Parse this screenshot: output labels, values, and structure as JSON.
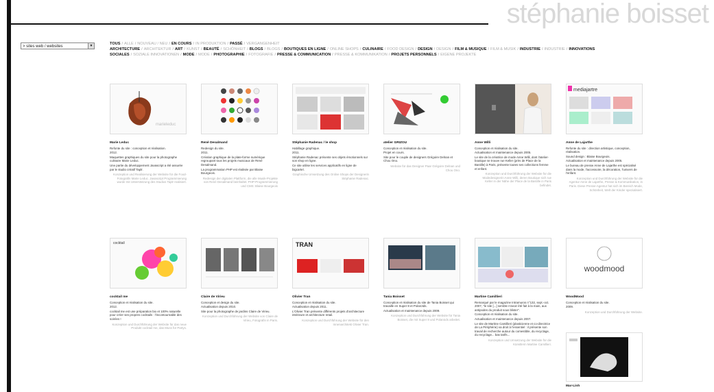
{
  "brand": {
    "name": "stéphanie boisset"
  },
  "selector": {
    "value": "> sites web / websites"
  },
  "nav": {
    "rows": [
      [
        {
          "t": "TOUS",
          "on": true
        },
        {
          "t": "/",
          "sep": true
        },
        {
          "t": "ALLE",
          "on": false
        },
        {
          "t": "/",
          "sep": true
        },
        {
          "t": "NOUVEAU / NEU",
          "on": false
        },
        {
          "t": "/",
          "sep": true
        },
        {
          "t": "EN COURS",
          "on": true
        },
        {
          "t": "/",
          "sep": true
        },
        {
          "t": "IN PRODUKTION",
          "on": false
        },
        {
          "t": "/",
          "sep": true
        },
        {
          "t": "PASSÉ",
          "on": true
        },
        {
          "t": "/",
          "sep": true
        },
        {
          "t": "VERGANGENHEIT",
          "on": false
        }
      ],
      [
        {
          "t": "ARCHITECTURE",
          "on": true
        },
        {
          "t": "/",
          "sep": true
        },
        {
          "t": "ARCHITEKTUR",
          "on": false
        },
        {
          "t": "/",
          "sep": true
        },
        {
          "t": "ART",
          "on": true
        },
        {
          "t": "/",
          "sep": true
        },
        {
          "t": "KUNST",
          "on": false
        },
        {
          "t": "/",
          "sep": true
        },
        {
          "t": "BEAUTÉ",
          "on": true
        },
        {
          "t": "/",
          "sep": true
        },
        {
          "t": "SCHÖNHEIT",
          "on": false
        },
        {
          "t": "/",
          "sep": true
        },
        {
          "t": "BLOGS",
          "on": true
        },
        {
          "t": "/",
          "sep": true
        },
        {
          "t": "BLOGS",
          "on": false
        },
        {
          "t": "/",
          "sep": true
        },
        {
          "t": "BOUTIQUES EN LIGNE",
          "on": true
        },
        {
          "t": "/",
          "sep": true
        },
        {
          "t": "ONLINE SHOPS",
          "on": false
        },
        {
          "t": "/",
          "sep": true
        },
        {
          "t": "CULINAIRE",
          "on": true
        },
        {
          "t": "/",
          "sep": true
        },
        {
          "t": "FOOD DESIGN",
          "on": false
        },
        {
          "t": "/",
          "sep": true
        },
        {
          "t": "DESIGN",
          "on": true
        },
        {
          "t": "/",
          "sep": true
        },
        {
          "t": "DESIGN",
          "on": false
        },
        {
          "t": "/",
          "sep": true
        },
        {
          "t": "FILM & MUSIQUE",
          "on": true
        },
        {
          "t": "/",
          "sep": true
        },
        {
          "t": "FILM & MUSIK",
          "on": false
        },
        {
          "t": "/",
          "sep": true
        },
        {
          "t": "INDUSTRIE",
          "on": true
        },
        {
          "t": "/",
          "sep": true
        },
        {
          "t": "INDUSTRIE",
          "on": false
        },
        {
          "t": "/",
          "sep": true
        },
        {
          "t": "INNOVATIONS",
          "on": true
        }
      ],
      [
        {
          "t": "SOCIALES",
          "on": true
        },
        {
          "t": "/",
          "sep": true
        },
        {
          "t": "SOZIALE INNOVATIONEN",
          "on": false
        },
        {
          "t": "/",
          "sep": true
        },
        {
          "t": "MODE",
          "on": true
        },
        {
          "t": "/",
          "sep": true
        },
        {
          "t": "MODE",
          "on": false
        },
        {
          "t": "/",
          "sep": true
        },
        {
          "t": "PHOTOGRAPHIE",
          "on": true
        },
        {
          "t": "/",
          "sep": true
        },
        {
          "t": "FOTOGRAFIE",
          "on": false
        },
        {
          "t": "/",
          "sep": true
        },
        {
          "t": "PRESSE & COMMUNICATION",
          "on": true
        },
        {
          "t": "/",
          "sep": true
        },
        {
          "t": "PRESSE & KOMMUNIKATION",
          "on": false
        },
        {
          "t": "/",
          "sep": true
        },
        {
          "t": "PROJETS PERSONNELS",
          "on": true
        },
        {
          "t": "/",
          "sep": true
        },
        {
          "t": "EIGENE PROJEKTE",
          "on": false
        }
      ]
    ]
  },
  "cards": [
    {
      "title": "Marie Leduc",
      "desc": [
        "Refonte du site : conception et réalisation.",
        "2012.",
        "Maquettes graphiques du site pour la photographe culinaire Marie Leduc.",
        "Une partie du développement Javascript a été assurée par le studio créatif Taplr."
      ],
      "de": "Konzeption und Realisierung der Website für die Food-Fotografin Marie Leduc. Javascript Programmierung wurde mit Unterstützung des Studios Taplr realisiert."
    },
    {
      "title": "René Desalmand",
      "desc": [
        "Redesign du site.",
        "2011.",
        "Création graphique de la plate-forme numérique regroupant tous les projets musicaux de René Desalmand.",
        "La programmation PHP est réalisée par Blaise Bourgeois."
      ],
      "de": "Redesign der digitalen Plattform, die alle Musik-Projekte von René Desalmand beinhaltet. PHP-Programmierung und CMS: Blaise Bourgeois"
    },
    {
      "title": "Stéphanie Radenac / le shop",
      "desc": [
        "Habillage graphique.",
        "2011.",
        "Stéphanie Radenac présente ses objets émotionnels sur son shop en ligne.",
        "Ce site utilise les services applicatifs en ligne de bigcartel."
      ],
      "de": "Graphische Umsetzung des Online Shops der Designerin Stéphanie Radenac."
    },
    {
      "title": "atelier GRIZOU",
      "desc": [
        "Conception et réalisation du site.",
        "Projet en cours.",
        "Site pour le couple de designers Grégoire Delnan et Chou Ono."
      ],
      "de": "Website für das Designer Paar Grégoire Delnan und Chou Ono."
    },
    {
      "title": "Anne Willi",
      "desc": [
        "Conception et réalisation du site.",
        "Actualisation et maintenance depuis 2005.",
        "Le site de la créatrice de mode Anne Willi, dont l'atelier-boutique se trouve rue Keller (près de Place de la Bastille) à Paris, présente toutes ses collections femme et enfant."
      ],
      "de": "Konzeption und Durchführung der Website für die Modedesignerin Anne Willi, deren Boutique sich rue Keller in der Nähe der Place de la Bastille in Paris befindet."
    },
    {
      "title": "Anne de Lajarthe",
      "desc": [
        "Refonte du site : direction artistique, conception, réalisation.",
        "Sound design : Blaise Bourgeois.",
        "Actualisation et maintenance depuis 2005.",
        "Le bureau de presse Anne de Lajarthe est spécialisé dans la mode, l'accessoire, la décoration, l'univers de l'enfant."
      ],
      "de": "Konzeption und Durchführung der Website für die Agentur Anne de Lajarthe, Presse & Kommunikation, in Paris. Diese Presse-Agentur hat sich im Bereich Mode, Schönheit, Welt der Kinder spezialisiert."
    },
    {
      "title": "cocktail me",
      "desc": [
        "Conception et réalisation du site.",
        "2012.",
        "cocktail me est une préparation bio et 100% naturelle pour créer ses propres cocktails : l'incontournable des soirées !"
      ],
      "de": "Konzeption und Durchführung der Website für das neue Produkt cocktail me, das Muss für Partys."
    },
    {
      "title": "Claire de Virieu",
      "desc": [
        "Conception et design du site.",
        "Actualisation depuis 2010.",
        "Site pour la photographe de jardins Claire de Virieu."
      ],
      "de": "Konzeption und Durchführung der Website von Claire de Virieu, Fotografin in Paris."
    },
    {
      "title": "Olivier Tran",
      "desc": [
        "Conception et réalisation du site.",
        "Actualisation depuis 2011.",
        "L'Olivier Tran présente différents projets d'architecture intérieure et architecture retail."
      ],
      "de": "Konzeption und Durchführung der Website für den Innenarchitekt Olivier Tran."
    },
    {
      "title": "Tania Boisset",
      "desc": [
        "Conception et réalisation du site de Tania Boisset qui travaille en Super 8 et Polaroïds.",
        "Actualisation et maintenance depuis 2009."
      ],
      "de": "Konzeption und Durchführung der Website für Tania Boisset, die mit Super 8 und Polaroids arbeitet."
    },
    {
      "title": "Martine Camillieri",
      "desc": [
        "Remarqué par le magazine Intramuros n°132, sept.-oct. 2007, \"le site [...] semble n'avoir été fait à la main, aux antipodes du produit sous blister\".",
        "Conception et réalisation du site.",
        "Actualisation et maintenance depuis 2007.",
        "Le site de Martine Camillieri (plasticienne et co-directrice de La Périphérie) va droit à l'essentiel : il présente son travail de recherche autour du comestible, du recyclage, du recyclage... bas tarifs..."
      ],
      "de": "Konzeption und Umsetzung der Website für die Künstlerin Martine Camillieri."
    },
    {
      "title": "WoodMood",
      "desc": [
        "Conception et réalisation du site.",
        "2009."
      ],
      "de": "Konzeption und Durchführung der Website."
    },
    {
      "title": "Mar-Linh",
      "desc": [],
      "de": ""
    }
  ],
  "thumbs": {
    "woodmood_logo": "woodmood",
    "mediajarthe_logo": "mediajartre",
    "cocktail_logo": "cocktail",
    "oliviertran_logo": "TRAN"
  }
}
